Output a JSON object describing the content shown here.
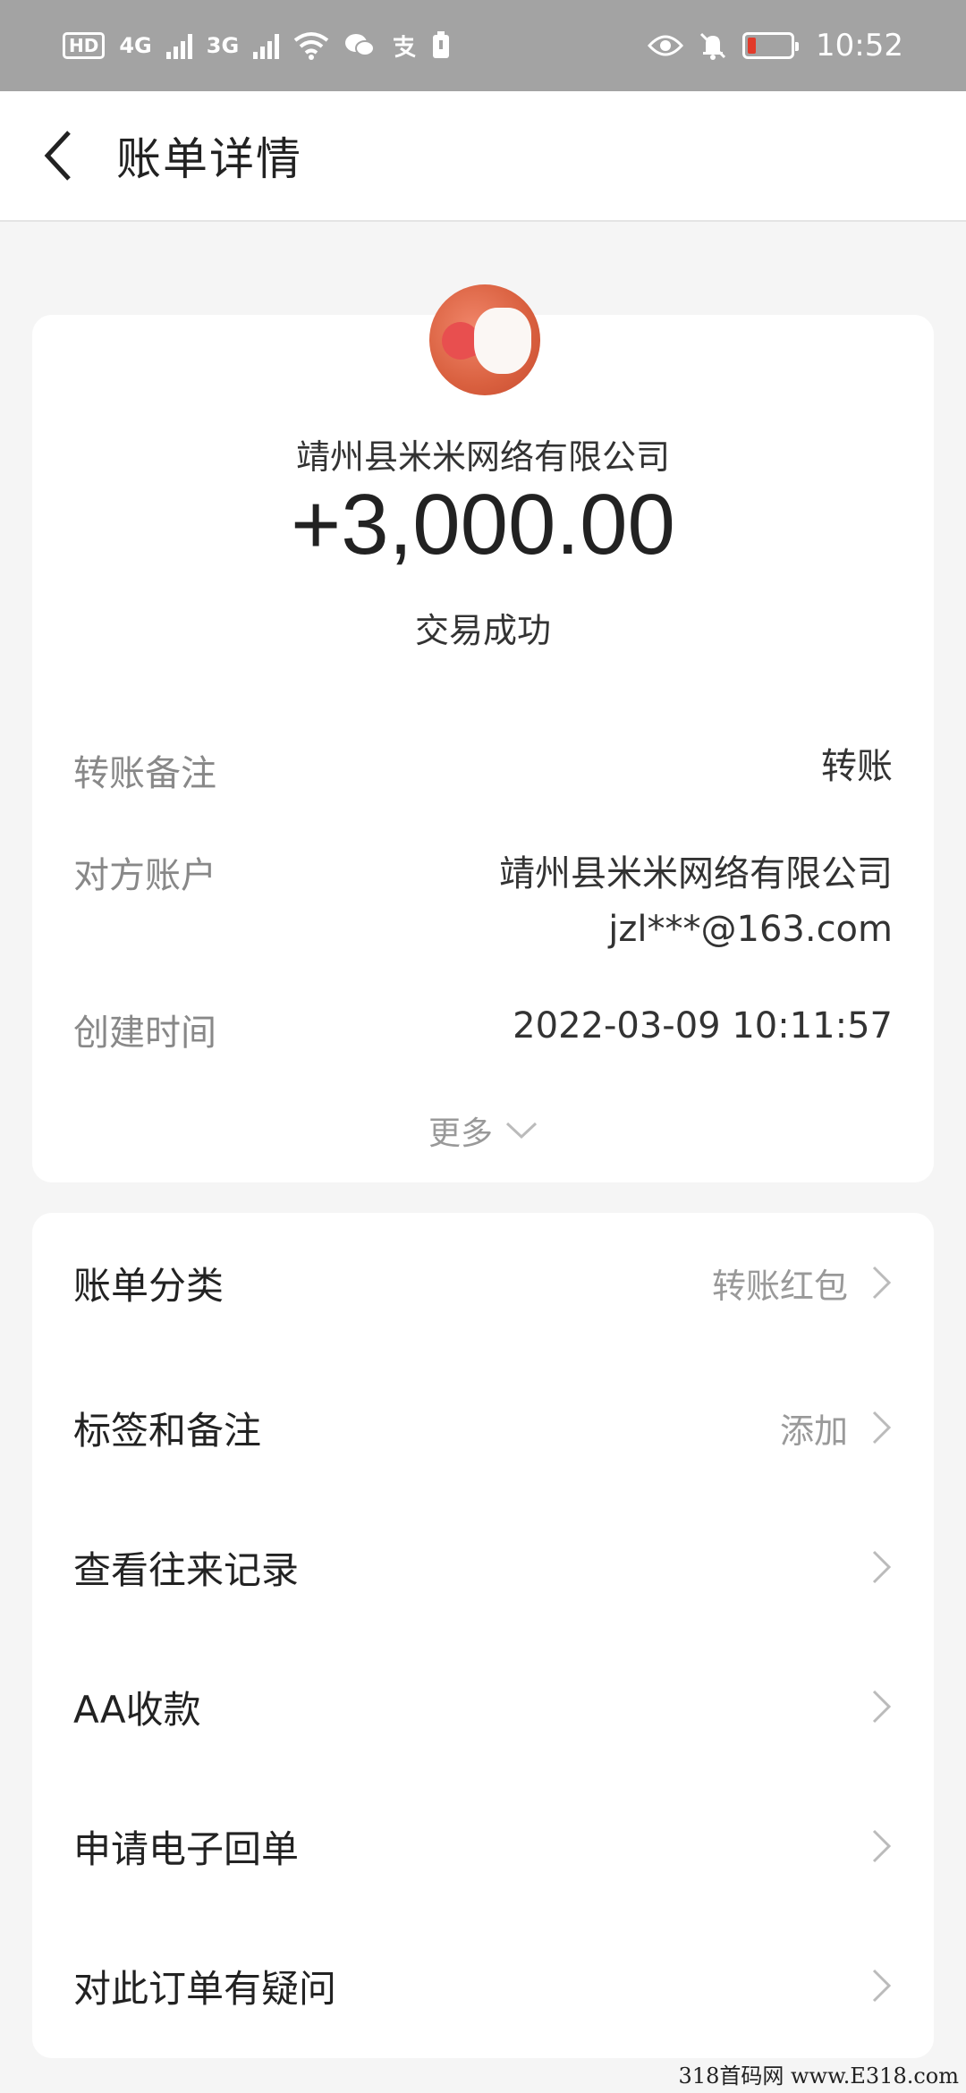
{
  "status_bar": {
    "hd": "HD",
    "sim1": "4G",
    "sim2": "3G",
    "time": "10:52",
    "icons": [
      "hd-icon",
      "signal-4g-icon",
      "signal-3g-icon",
      "wifi-icon",
      "wechat-icon",
      "alipay-icon",
      "sim-icon",
      "eye-icon",
      "bell-off-icon",
      "battery-low-icon"
    ]
  },
  "header": {
    "title": "账单详情"
  },
  "transaction": {
    "company": "靖州县米米网络有限公司",
    "amount": "+3,000.00",
    "status": "交易成功"
  },
  "details": [
    {
      "label": "转账备注",
      "value": "转账"
    },
    {
      "label": "对方账户",
      "value": "靖州县米米网络有限公司 jzl***@163.com"
    },
    {
      "label": "创建时间",
      "value": "2022-03-09 10:11:57"
    }
  ],
  "more_label": "更多",
  "menu": [
    {
      "label": "账单分类",
      "value": "转账红包"
    },
    {
      "label": "标签和备注",
      "value": "添加"
    },
    {
      "label": "查看往来记录",
      "value": ""
    },
    {
      "label": "AA收款",
      "value": ""
    },
    {
      "label": "申请电子回单",
      "value": ""
    },
    {
      "label": "对此订单有疑问",
      "value": ""
    }
  ],
  "watermark": "318首码网 www.E318.com",
  "colors": {
    "status_bar_bg": "#a3a3a3",
    "page_bg": "#f5f5f5",
    "card_bg": "#ffffff",
    "label_gray": "#888888",
    "battery_low": "#e23a2a"
  }
}
